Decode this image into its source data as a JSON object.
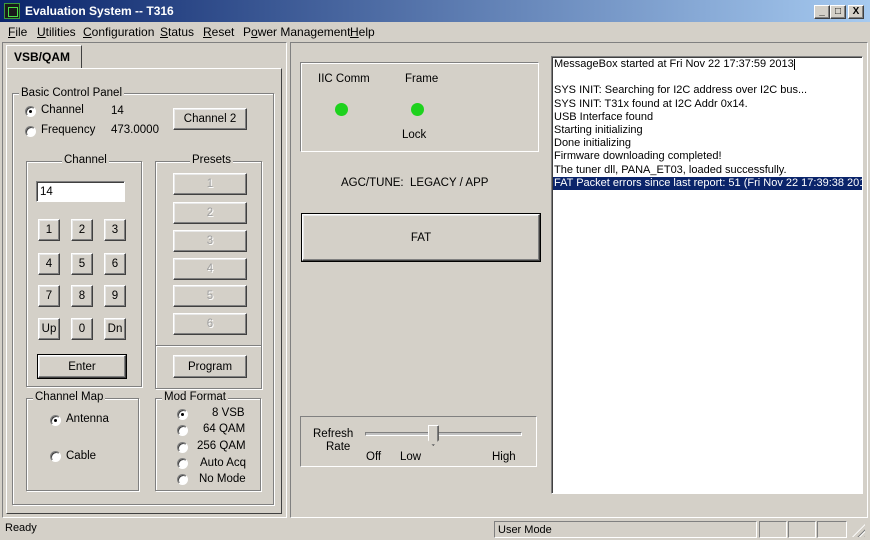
{
  "window": {
    "title": "Evaluation System -- T316",
    "min": "_",
    "max": "□",
    "close": "X"
  },
  "menu": [
    {
      "key": "F",
      "rest": "ile"
    },
    {
      "key": "U",
      "rest": "tilities"
    },
    {
      "key": "C",
      "rest": "onfiguration"
    },
    {
      "key": "S",
      "rest": "tatus"
    },
    {
      "key": "R",
      "rest": "eset"
    },
    {
      "key": "Po",
      "rest": "wer Management",
      "underline_index": 1
    },
    {
      "key": "H",
      "rest": "elp"
    }
  ],
  "tab": {
    "label": "VSB/QAM"
  },
  "basic_control": {
    "title": "Basic Control Panel",
    "channel_label": "Channel",
    "channel_value": "14",
    "frequency_label": "Frequency",
    "frequency_value": "473.0000",
    "channel2_button": "Channel 2",
    "mode_selected": "Channel"
  },
  "channel_group": {
    "title": "Channel",
    "input_value": "14",
    "keys": [
      "1",
      "2",
      "3",
      "4",
      "5",
      "6",
      "7",
      "8",
      "9",
      "Up",
      "0",
      "Dn"
    ],
    "enter": "Enter"
  },
  "presets": {
    "title": "Presets",
    "items": [
      "1",
      "2",
      "3",
      "4",
      "5",
      "6"
    ],
    "program": "Program"
  },
  "channel_map": {
    "title": "Channel Map",
    "options": [
      "Antenna",
      "Cable"
    ],
    "selected": "Antenna"
  },
  "mod_format": {
    "title": "Mod Format",
    "options": [
      "8 VSB",
      "64 QAM",
      "256 QAM",
      "Auto Acq",
      "No Mode"
    ],
    "selected": "8 VSB"
  },
  "status_lights": {
    "iic_label": "IIC Comm",
    "frame_label": "Frame",
    "lock_label": "Lock",
    "led_color": "#1ed21e"
  },
  "agc": {
    "label": "AGC/TUNE:",
    "value": "LEGACY / APP"
  },
  "fat_button": "FAT",
  "refresh": {
    "label_line1": "Refresh",
    "label_line2": "Rate",
    "off": "Off",
    "low": "Low",
    "high": "High",
    "level_fraction": 0.43
  },
  "messages": [
    {
      "text": "MessageBox started at Fri Nov 22 17:37:59 2013",
      "selected": false
    },
    {
      "text": "",
      "selected": false
    },
    {
      "text": "SYS INIT: Searching for I2C address over I2C bus...",
      "selected": false
    },
    {
      "text": "SYS INIT: T31x found at I2C Addr 0x14.",
      "selected": false
    },
    {
      "text": "USB Interface found",
      "selected": false
    },
    {
      "text": "Starting initializing",
      "selected": false
    },
    {
      "text": "Done initializing",
      "selected": false
    },
    {
      "text": "Firmware downloading completed!",
      "selected": false
    },
    {
      "text": "The tuner dll, PANA_ET03, loaded successfully.",
      "selected": false
    },
    {
      "text": "FAT Packet errors since last report:  51  (Fri Nov 22 17:39:38 201",
      "selected": true
    }
  ],
  "statusbar": {
    "left": "Ready",
    "mode": "User Mode"
  },
  "colors": {
    "titlebar_start": "#0a246a",
    "titlebar_end": "#a6caf0",
    "selection": "#0a246a"
  }
}
